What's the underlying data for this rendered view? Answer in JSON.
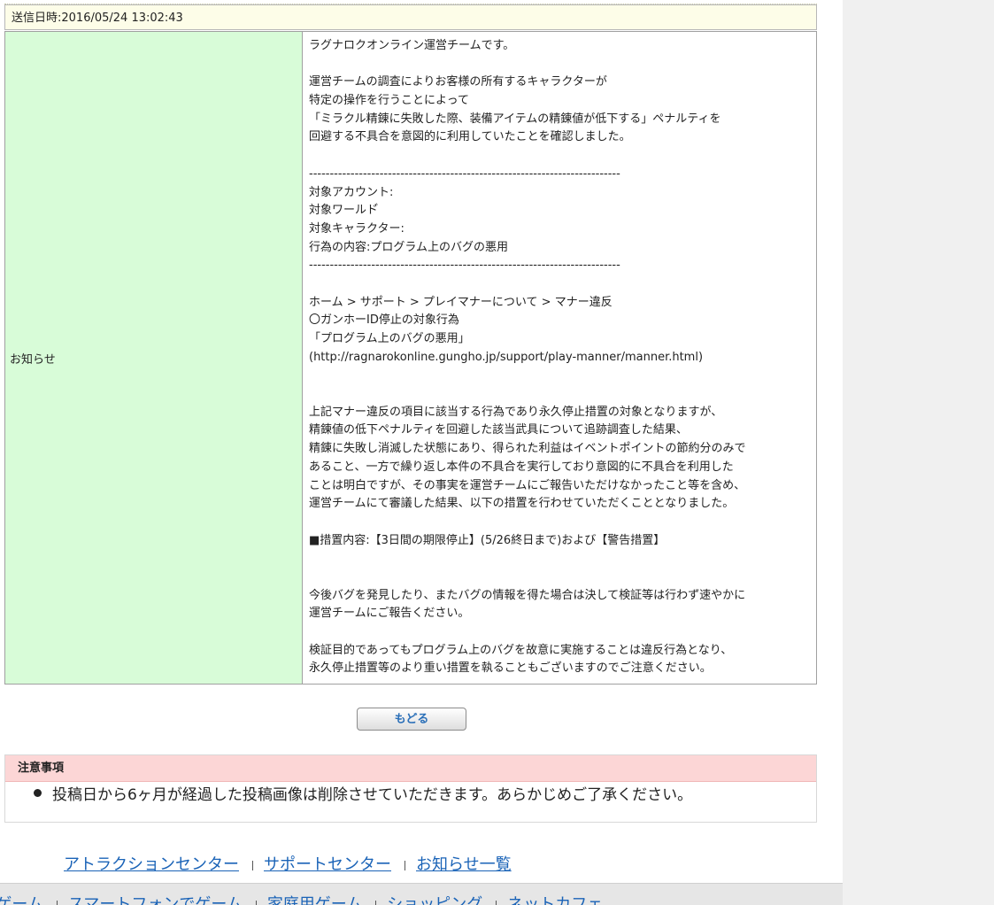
{
  "header": {
    "sent_label": "送信日時:2016/05/24 13:02:43"
  },
  "message": {
    "label": "お知らせ",
    "lines": [
      "ラグナロクオンライン運営チームです。",
      "",
      "運営チームの調査によりお客様の所有するキャラクターが",
      "特定の操作を行うことによって",
      "「ミラクル精錬に失敗した際、装備アイテムの精錬値が低下する」ペナルティを",
      "回避する不具合を意図的に利用していたことを確認しました。",
      "",
      "---------------------------------------------------------------------------",
      "対象アカウント:",
      "対象ワールド゙",
      "対象キャラクター:",
      "行為の内容:プログラム上のバグの悪用",
      "---------------------------------------------------------------------------",
      "",
      "ホーム > サポート > プレイマナーについて > マナー違反",
      "〇ガンホーID停止の対象行為",
      "「プログラム上のバグの悪用」",
      "(http://ragnarokonline.gungho.jp/support/play-manner/manner.html)",
      "",
      "",
      "上記マナー違反の項目に該当する行為であり永久停止措置の対象となりますが、",
      "精錬値の低下ペナルティを回避した該当武具について追跡調査した結果、",
      "精錬に失敗し消滅した状態にあり、得られた利益はイベントポイントの節約分のみで",
      "あること、一方で繰り返し本件の不具合を実行しており意図的に不具合を利用した",
      "ことは明白ですが、その事実を運営チームにご報告いただけなかったこと等を含め、",
      "運営チームにて審議した結果、以下の措置を行わせていただくこととなりました。",
      "",
      "■措置内容:【3日間の期限停止】(5/26終日まで)および【警告措置】",
      "",
      "",
      "今後バグを発見したり、またバグの情報を得た場合は決して検証等は行わず速やかに",
      "運営チームにご報告ください。",
      "",
      "検証目的であってもプログラム上のバグを故意に実施することは違反行為となり、",
      "永久停止措置等のより重い措置を執ることもございますのでご注意ください。"
    ]
  },
  "back_button": {
    "label": "もどる"
  },
  "notice": {
    "title": "注意事項",
    "item": "投稿日から6ヶ月が経過した投稿画像は削除させていただきます。あらかじめご了承ください。"
  },
  "footer_links": [
    "アトラクションセンター",
    "サポートセンター",
    "お知らせ一覧"
  ],
  "footer_bar_links": [
    "PCゲーム",
    "スマートフォンでゲーム",
    "家庭用ゲーム",
    "ショッピング",
    "ネットカフェ"
  ],
  "colors": {
    "label_bg": "#d8fcd8",
    "notice_head_bg": "#fcd6d6",
    "link": "#1a63b7"
  }
}
